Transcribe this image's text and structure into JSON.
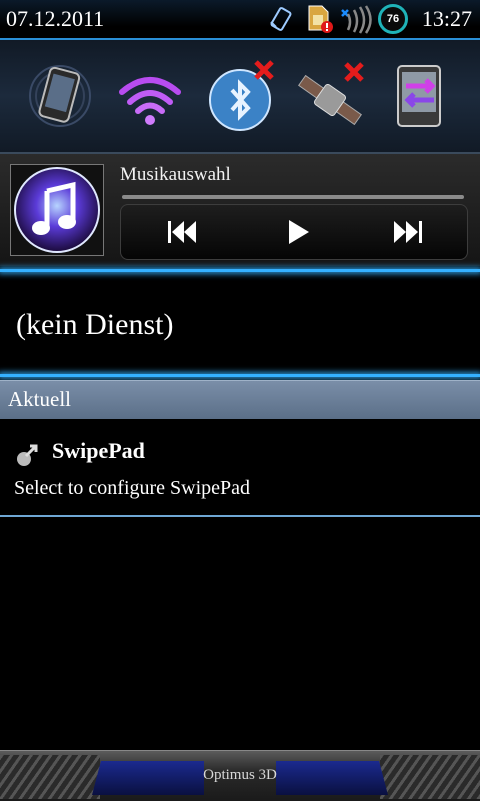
{
  "status_bar": {
    "date": "07.12.2011",
    "time": "13:27",
    "battery_level": "76",
    "icons": [
      "rotate-icon",
      "sim-card-error-icon",
      "no-signal-icon",
      "battery-icon"
    ]
  },
  "toggles": [
    {
      "name": "phone-toggle",
      "icon": "phone-icon"
    },
    {
      "name": "wifi-toggle",
      "icon": "wifi-icon"
    },
    {
      "name": "bluetooth-toggle",
      "icon": "bluetooth-icon",
      "state": "off"
    },
    {
      "name": "gps-toggle",
      "icon": "satellite-icon",
      "state": "off"
    },
    {
      "name": "sync-toggle",
      "icon": "data-transfer-icon"
    }
  ],
  "music": {
    "title": "Musikauswahl",
    "controls": [
      "previous",
      "play",
      "next"
    ]
  },
  "carrier": {
    "text": "(kein Dienst)"
  },
  "notifications": {
    "header": "Aktuell",
    "items": [
      {
        "title": "SwipePad",
        "text": "Select to configure SwipePad",
        "icon": "swipepad-icon"
      }
    ]
  },
  "handle": {
    "label": "Optimus 3D"
  },
  "colors": {
    "accent": "#35b1ff",
    "header_bg": "#6a7f98",
    "battery_ring": "#1fb3b8"
  }
}
